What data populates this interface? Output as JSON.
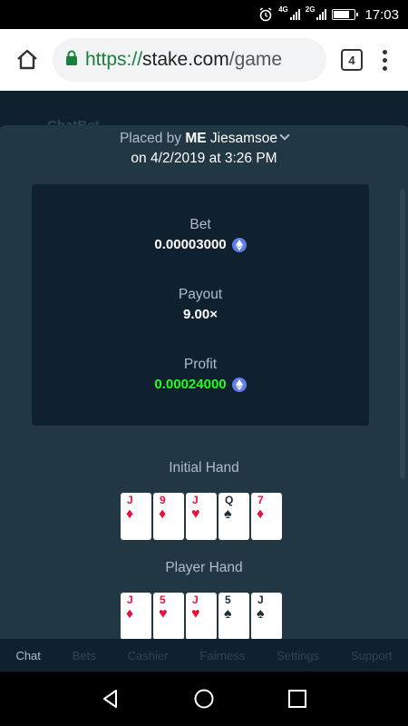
{
  "status_bar": {
    "time": "17:03",
    "net1": "4G",
    "net2": "2G",
    "battery_level": 0.8
  },
  "browser": {
    "url_scheme": "https://",
    "url_host": "stake.com",
    "url_path": "/game",
    "tab_count": "4"
  },
  "background": {
    "header_text": "ChatBet"
  },
  "modal": {
    "placed_by_prefix": "Placed by",
    "placed_by_tag": "ME",
    "placed_by_user": "Jiesamsoe",
    "placed_on": "on 4/2/2019 at 3:26 PM",
    "bet_label": "Bet",
    "bet_value": "0.00003000",
    "payout_label": "Payout",
    "payout_value": "9.00×",
    "profit_label": "Profit",
    "profit_value": "0.00024000",
    "initial_hand_title": "Initial Hand",
    "player_hand_title": "Player Hand",
    "initial_hand": [
      {
        "rank": "J",
        "suit": "♦",
        "color": "red"
      },
      {
        "rank": "9",
        "suit": "♦",
        "color": "red"
      },
      {
        "rank": "J",
        "suit": "♥",
        "color": "red"
      },
      {
        "rank": "Q",
        "suit": "♠",
        "color": "black"
      },
      {
        "rank": "7",
        "suit": "♦",
        "color": "red"
      }
    ],
    "player_hand": [
      {
        "rank": "J",
        "suit": "♦",
        "color": "red"
      },
      {
        "rank": "5",
        "suit": "♥",
        "color": "red"
      },
      {
        "rank": "J",
        "suit": "♥",
        "color": "red"
      },
      {
        "rank": "5",
        "suit": "♠",
        "color": "black"
      },
      {
        "rank": "J",
        "suit": "♠",
        "color": "black"
      }
    ]
  },
  "app_nav": {
    "items": [
      "Chat",
      "Bets",
      "Cashier",
      "Fairness",
      "Settings",
      "Support"
    ]
  },
  "colors": {
    "modal_bg": "#213743",
    "stats_bg": "#0f212e",
    "profit_green": "#1fff20",
    "card_red": "#e9113c",
    "eth_blue": "#627eea"
  }
}
